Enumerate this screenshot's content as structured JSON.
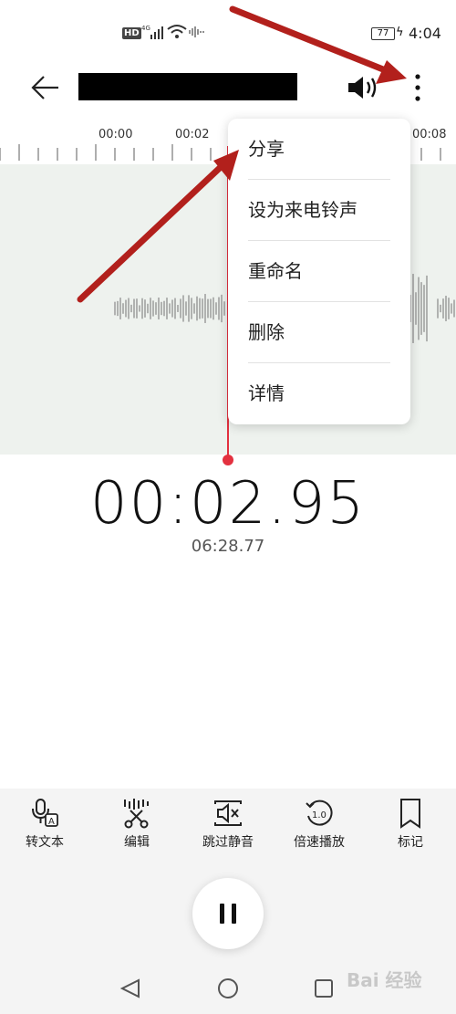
{
  "status_bar": {
    "hd": "HD",
    "network": "4G",
    "battery": "77",
    "time": "4:04"
  },
  "header": {
    "back_icon": "arrow-left-icon",
    "speaker_icon": "speaker-icon",
    "more_icon": "more-vertical-icon"
  },
  "ruler": {
    "labels": [
      "00:00",
      "00:02",
      "00:08"
    ]
  },
  "playback": {
    "current_time": "00:02.95",
    "total_time": "06:28.77"
  },
  "menu": {
    "items": [
      "分享",
      "设为来电铃声",
      "重命名",
      "删除",
      "详情"
    ]
  },
  "toolbar": {
    "items": [
      {
        "label": "转文本",
        "icon": "speech-to-text-icon"
      },
      {
        "label": "编辑",
        "icon": "scissors-edit-icon"
      },
      {
        "label": "跳过静音",
        "icon": "skip-silence-icon"
      },
      {
        "label": "倍速播放",
        "icon": "playback-speed-icon",
        "badge": "1.0"
      },
      {
        "label": "标记",
        "icon": "bookmark-icon"
      }
    ]
  },
  "nav": {
    "back_icon": "nav-back-icon",
    "home_icon": "nav-home-icon",
    "recents_icon": "nav-recents-icon"
  },
  "colors": {
    "accent": "#e3313f",
    "wave_bg": "#eef2ee",
    "arrow": "#b2201c"
  },
  "watermark": "Bai 经验"
}
